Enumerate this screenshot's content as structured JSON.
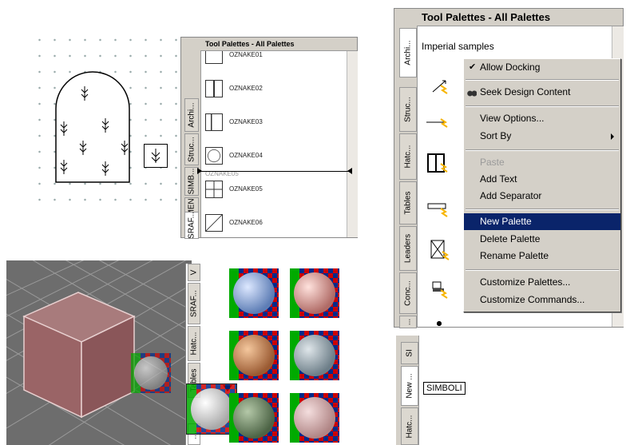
{
  "palette_top_left": {
    "title": "Tool Palettes - All Palettes",
    "tabs": [
      "Archi...",
      "Struc...",
      "SIMB...",
      "KAMEN...",
      "SRAF..."
    ],
    "tools": [
      {
        "label": "OZNAKE01",
        "icon": "symbol-icon"
      },
      {
        "label": "OZNAKE02",
        "icon": "double-door-icon"
      },
      {
        "label": "OZNAKE03",
        "icon": "door-icon"
      },
      {
        "label": "OZNAKE04",
        "icon": "circle-square-icon"
      },
      {
        "label": "OZNAKE05",
        "icon": "grid-window-icon"
      },
      {
        "label": "OZNAKE06",
        "icon": "diagonal-square-icon"
      }
    ],
    "drag_ghost_label": "OZNAKE05"
  },
  "palette_right": {
    "title": "Tool Palettes - All Palettes",
    "subtitle": "Imperial samples",
    "tabs": [
      "Archi...",
      "Struc...",
      "Hatc...",
      "Tables",
      "Leaders",
      "Conc...",
      "..."
    ],
    "context_menu": {
      "items": [
        {
          "label": "Allow Docking",
          "checked": true
        },
        {
          "label": "Seek Design Content",
          "icon": "binoculars-icon"
        },
        {
          "label": "View Options..."
        },
        {
          "label": "Sort By",
          "submenu": true
        },
        {
          "label": "Paste",
          "disabled": true
        },
        {
          "label": "Add Text"
        },
        {
          "label": "Add Separator"
        },
        {
          "label": "New Palette",
          "highlighted": true
        },
        {
          "label": "Delete Palette"
        },
        {
          "label": "Rename Palette"
        },
        {
          "label": "Customize Palettes..."
        },
        {
          "label": "Customize Commands..."
        }
      ]
    }
  },
  "palette_bottom_left": {
    "tabs": [
      "SRAF...",
      "Hatc...",
      "Tables",
      "...."
    ],
    "top_tab_fragment": "V"
  },
  "palette_bottom_right": {
    "tabs": [
      "Hatc...",
      "New ...",
      "SI"
    ],
    "tool_label": "SIMBOLI"
  },
  "colors": {
    "menu_highlight": "#0a246a",
    "panel_gray": "#d4d0c8",
    "accent_orange": "#f7b500"
  }
}
